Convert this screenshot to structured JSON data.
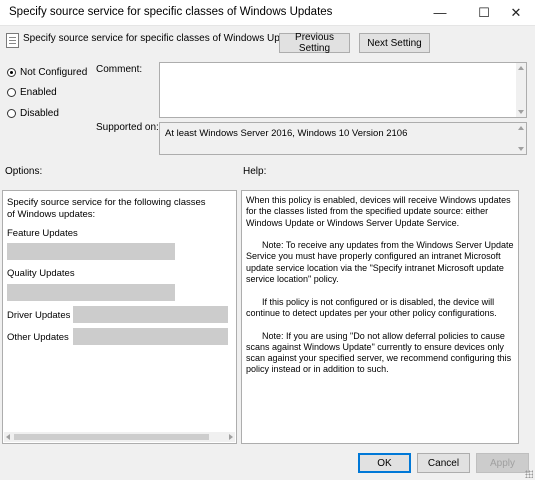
{
  "window": {
    "title": "Specify source service for specific classes of Windows Updates",
    "minimize_glyph": "—",
    "maximize_glyph": "☐",
    "close_glyph": "✕"
  },
  "header": {
    "policy_title": "Specify source service for specific classes of Windows Updates",
    "previous_label": "Previous Setting",
    "next_label": "Next Setting"
  },
  "state": {
    "options": [
      {
        "label": "Not Configured",
        "selected": true
      },
      {
        "label": "Enabled",
        "selected": false
      },
      {
        "label": "Disabled",
        "selected": false
      }
    ]
  },
  "comment": {
    "label": "Comment:",
    "value": ""
  },
  "supported": {
    "label": "Supported on:",
    "value": "At least Windows Server 2016, Windows 10 Version 2106"
  },
  "options_panel": {
    "heading": "Options:",
    "intro": "Specify source service for the following classes of Windows updates:",
    "feature_label": "Feature Updates",
    "quality_label": "Quality Updates",
    "driver_label": "Driver Updates",
    "other_label": "Other Updates"
  },
  "help_panel": {
    "heading": "Help:",
    "paragraphs": [
      "When this policy is enabled, devices will receive Windows updates for the classes listed from the specified update source: either Windows Update or Windows Server Update Service.",
      "Note: To receive any updates from the Windows Server Update Service you must have properly configured an intranet Microsoft update service location via the \"Specify intranet Microsoft update service location\" policy.",
      "If this policy is not configured or is disabled, the device will continue to detect updates per your other policy configurations.",
      "Note: If you are using \"Do not allow deferral policies to cause scans against Windows Update\" currently to ensure devices only scan against your specified server, we recommend configuring this policy instead or in addition to such."
    ]
  },
  "footer": {
    "ok_label": "OK",
    "cancel_label": "Cancel",
    "apply_label": "Apply"
  }
}
